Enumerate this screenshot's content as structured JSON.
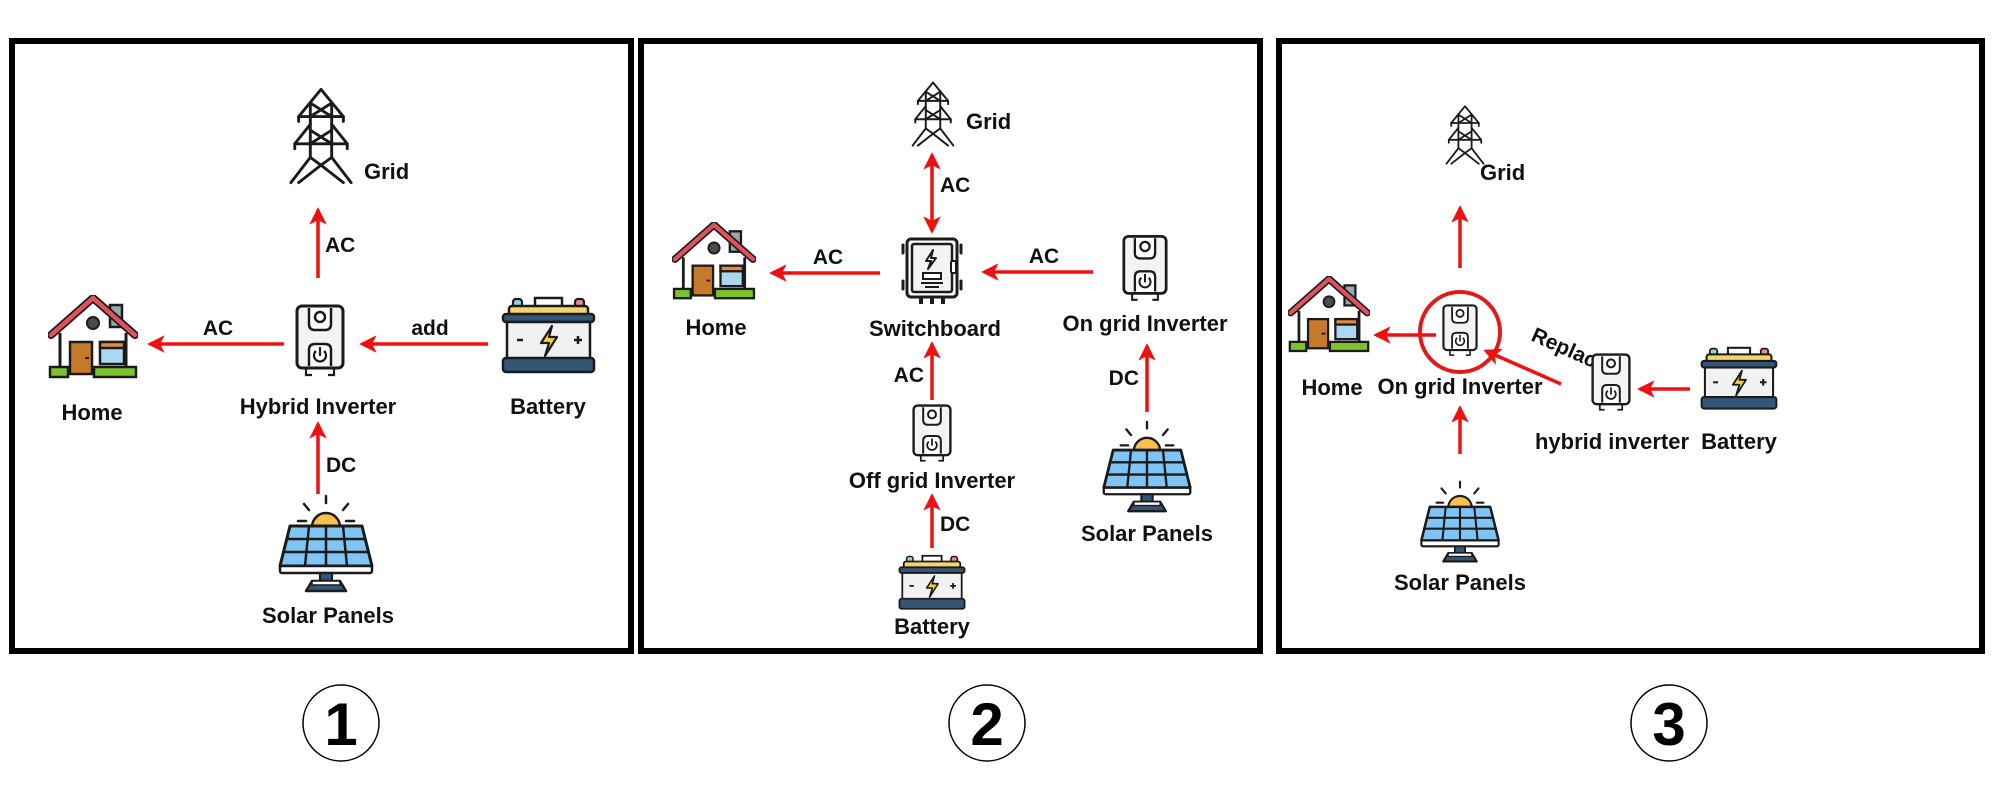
{
  "colors": {
    "arrow": "#ee1111",
    "highlight_ring": "#e21a1a",
    "frame": "#000000",
    "roof": "#e0505e",
    "door": "#c87a2c",
    "window": "#a9d8f0",
    "grass": "#7cc22a",
    "battery_top": "#f5d46a",
    "battery_base": "#355576",
    "solar_cell": "#7fc4f2",
    "sun": "#f6c14f"
  },
  "panels": [
    {
      "number": "1",
      "nodes": {
        "grid": {
          "label": "Grid",
          "icon": "transmission-tower-icon"
        },
        "home": {
          "label": "Home",
          "icon": "house-icon"
        },
        "inverter": {
          "label": "Hybrid Inverter",
          "icon": "inverter-icon"
        },
        "battery": {
          "label": "Battery",
          "icon": "battery-icon"
        },
        "solar": {
          "label": "Solar Panels",
          "icon": "solar-panel-icon"
        }
      },
      "edges": [
        {
          "from": "Hybrid Inverter",
          "to": "Grid",
          "label": "AC"
        },
        {
          "from": "Hybrid Inverter",
          "to": "Home",
          "label": "AC"
        },
        {
          "from": "Battery",
          "to": "Hybrid Inverter",
          "label": "add"
        },
        {
          "from": "Solar Panels",
          "to": "Hybrid Inverter",
          "label": "DC"
        }
      ]
    },
    {
      "number": "2",
      "nodes": {
        "grid": {
          "label": "Grid",
          "icon": "transmission-tower-icon"
        },
        "home": {
          "label": "Home",
          "icon": "house-icon"
        },
        "switchboard": {
          "label": "Switchboard",
          "icon": "switchboard-icon"
        },
        "ongrid": {
          "label": "On grid Inverter",
          "icon": "inverter-icon"
        },
        "offgrid": {
          "label": "Off grid Inverter",
          "icon": "inverter-icon"
        },
        "battery": {
          "label": "Battery",
          "icon": "battery-icon"
        },
        "solar": {
          "label": "Solar Panels",
          "icon": "solar-panel-icon"
        }
      },
      "edges": [
        {
          "from": "Switchboard",
          "to": "Grid",
          "label": "AC",
          "bidirectional": true
        },
        {
          "from": "Switchboard",
          "to": "Home",
          "label": "AC"
        },
        {
          "from": "On grid Inverter",
          "to": "Switchboard",
          "label": "AC"
        },
        {
          "from": "Off grid Inverter",
          "to": "Switchboard",
          "label": "AC"
        },
        {
          "from": "Battery",
          "to": "Off grid Inverter",
          "label": "DC"
        },
        {
          "from": "Solar Panels",
          "to": "On grid Inverter",
          "label": "DC"
        }
      ]
    },
    {
      "number": "3",
      "nodes": {
        "grid": {
          "label": "Grid",
          "icon": "transmission-tower-icon"
        },
        "home": {
          "label": "Home",
          "icon": "house-icon"
        },
        "ongrid": {
          "label": "On grid Inverter",
          "icon": "inverter-icon",
          "highlighted": true
        },
        "hybrid": {
          "label": "hybrid inverter",
          "icon": "inverter-icon"
        },
        "battery": {
          "label": "Battery",
          "icon": "battery-icon"
        },
        "solar": {
          "label": "Solar Panels",
          "icon": "solar-panel-icon"
        }
      },
      "edges": [
        {
          "from": "On grid Inverter",
          "to": "Grid",
          "label": ""
        },
        {
          "from": "On grid Inverter",
          "to": "Home",
          "label": ""
        },
        {
          "from": "hybrid inverter",
          "to": "On grid Inverter",
          "label": "Replace"
        },
        {
          "from": "Battery",
          "to": "hybrid inverter",
          "label": ""
        },
        {
          "from": "Solar Panels",
          "to": "On grid Inverter",
          "label": ""
        }
      ]
    }
  ]
}
